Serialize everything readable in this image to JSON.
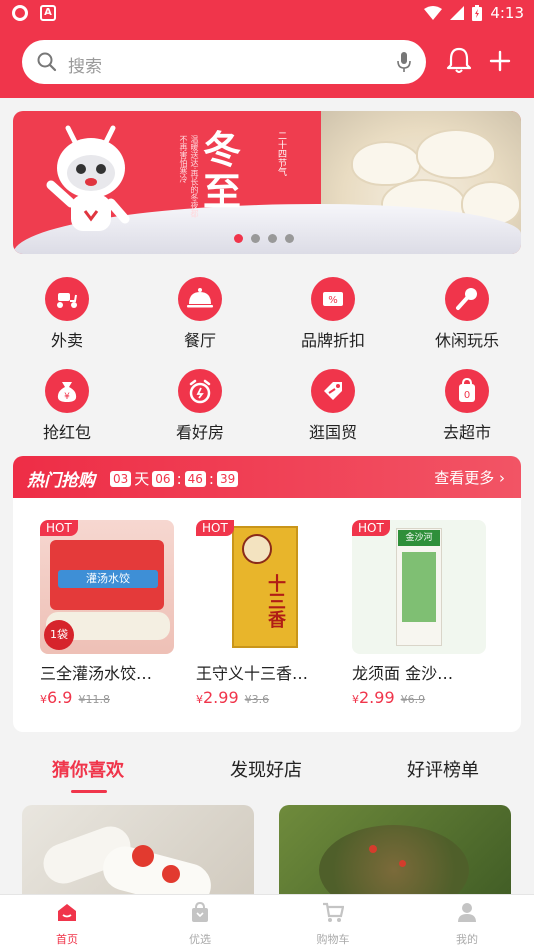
{
  "status_bar": {
    "time": "4:13"
  },
  "search": {
    "placeholder": "搜索"
  },
  "banner": {
    "title": "冬至",
    "subtitle": "二十四节气",
    "caption": "温暖送达·再长的冬夜都不再害怕寒冷",
    "slide_count": 4,
    "active_slide": 1
  },
  "categories": [
    {
      "label": "外卖",
      "icon": "scooter-icon"
    },
    {
      "label": "餐厅",
      "icon": "dining-cloche-icon"
    },
    {
      "label": "品牌折扣",
      "icon": "discount-ticket-icon"
    },
    {
      "label": "休闲玩乐",
      "icon": "microphone-icon"
    },
    {
      "label": "抢红包",
      "icon": "money-bag-icon"
    },
    {
      "label": "看好房",
      "icon": "alarm-clock-icon"
    },
    {
      "label": "逛国贸",
      "icon": "tag-icon"
    },
    {
      "label": "去超市",
      "icon": "shopping-bag-icon"
    }
  ],
  "flash_sale": {
    "title": "热门抢购",
    "days": "03",
    "days_unit": "天",
    "hours": "06",
    "minutes": "46",
    "seconds": "39",
    "more": "查看更多",
    "products": [
      {
        "tag": "HOT",
        "name": "三全灌汤水饺…",
        "price": "6.9",
        "old_price": "¥11.8",
        "currency": "¥",
        "pack_text": "灌汤水饺",
        "count_badge": "1袋"
      },
      {
        "tag": "HOT",
        "name": "王守义十三香…",
        "price": "2.99",
        "old_price": "¥3.6",
        "currency": "¥",
        "pack_text": "十三香"
      },
      {
        "tag": "HOT",
        "name": "龙须面 金沙…",
        "price": "2.99",
        "old_price": "¥6.9",
        "currency": "¥",
        "pack_text": "金沙河"
      }
    ]
  },
  "feed_tabs": [
    {
      "label": "猜你喜欢",
      "active": true
    },
    {
      "label": "发现好店",
      "active": false
    },
    {
      "label": "好评榜单",
      "active": false
    }
  ],
  "bottom_nav": [
    {
      "label": "首页",
      "icon": "home-icon",
      "active": true
    },
    {
      "label": "优选",
      "icon": "bag-icon",
      "active": false
    },
    {
      "label": "购物车",
      "icon": "cart-icon",
      "active": false
    },
    {
      "label": "我的",
      "icon": "user-icon",
      "active": false
    }
  ],
  "colors": {
    "accent": "#f0354b"
  }
}
